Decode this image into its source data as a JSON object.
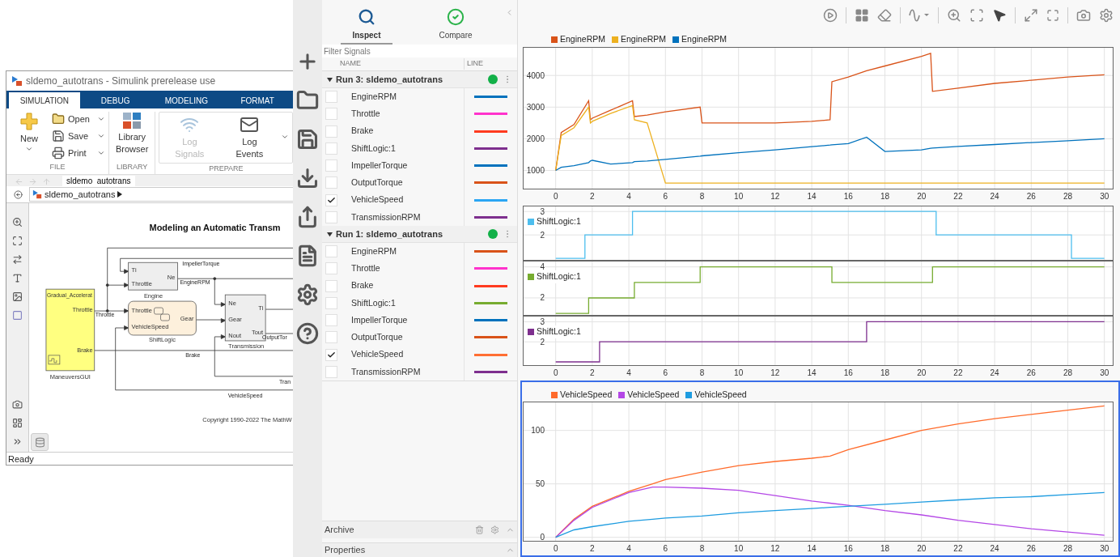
{
  "simulink_window": {
    "title": "sldemo_autotrans - Simulink prerelease use",
    "tabs": [
      {
        "label": "SIMULATION",
        "selected": true
      },
      {
        "label": "DEBUG",
        "selected": false
      },
      {
        "label": "MODELING",
        "selected": false
      },
      {
        "label": "FORMAT",
        "selected": false
      }
    ],
    "ribbon_sections": [
      {
        "title": "FILE",
        "kind": "plain",
        "buttons": [
          {
            "kind": "new",
            "label": "New",
            "disabled": false
          },
          {
            "kind": "open",
            "label": "Open",
            "disabled": false
          },
          {
            "kind": "save",
            "label": "Save",
            "disabled": false
          },
          {
            "kind": "print",
            "label": "Print",
            "disabled": false
          }
        ]
      },
      {
        "title": "LIBRARY",
        "kind": "plain",
        "buttons": [
          {
            "kind": "library",
            "label": "Library Browser",
            "disabled": false
          }
        ]
      },
      {
        "title": "PREPARE",
        "kind": "gallery",
        "buttons": [
          {
            "kind": "signals",
            "label": "Log Signals",
            "disabled": true
          },
          {
            "kind": "events",
            "label": "Log Events",
            "disabled": false
          }
        ]
      }
    ],
    "nav_tab": "sldemo  autotrans",
    "breadcrumb": "sldemo_autotrans",
    "diagram": {
      "title": "Modeling an Automatic Transm",
      "blocks": [
        {
          "name": "ManeuversGUI",
          "inner_title": "Gradual_Accelerat",
          "ports_out": [
            "Throttle",
            "Brake"
          ]
        },
        {
          "name": "Engine",
          "ports_in": [
            "Ti",
            "Throttle"
          ],
          "ports_out": [
            "Ne"
          ]
        },
        {
          "name": "ShiftLogic",
          "ports_in": [
            "Throttle",
            "VehicleSpeed"
          ],
          "ports_out": [
            "Gear"
          ]
        },
        {
          "name": "Transmission",
          "ports_in": [
            "Ne",
            "Gear",
            "Nout"
          ],
          "ports_out": [
            "Ti",
            "Tout"
          ]
        }
      ],
      "signals": [
        "ImpellerTorque",
        "EngineRPM",
        "Throttle",
        "Brake",
        "OutputTor",
        "Tran",
        "VehicleSpeed"
      ],
      "copyright": "Copyright 1990-2022 The MathW"
    },
    "status": "Ready"
  },
  "inspector": {
    "tabs": [
      {
        "label": "Inspect",
        "selected": true
      },
      {
        "label": "Compare",
        "selected": false
      }
    ],
    "filter": {
      "placeholder": "Filter Signals"
    },
    "columns": [
      "NAME",
      "LINE"
    ],
    "runs": [
      {
        "name": "Run 3: sldemo_autotrans",
        "expanded": true,
        "signals": [
          {
            "name": "EngineRPM",
            "checked": false,
            "color": "#0072bd"
          },
          {
            "name": "Throttle",
            "checked": false,
            "color": "#ff33cc"
          },
          {
            "name": "Brake",
            "checked": false,
            "color": "#ff3b1f"
          },
          {
            "name": "ShiftLogic:1",
            "checked": false,
            "color": "#7e2f8e"
          },
          {
            "name": "ImpellerTorque",
            "checked": false,
            "color": "#0072bd"
          },
          {
            "name": "OutputTorque",
            "checked": false,
            "color": "#d95319"
          },
          {
            "name": "VehicleSpeed",
            "checked": true,
            "color": "#2ba6f3"
          },
          {
            "name": "TransmissionRPM",
            "checked": false,
            "color": "#7e2f8e"
          }
        ]
      },
      {
        "name": "Run 1: sldemo_autotrans",
        "expanded": true,
        "signals": [
          {
            "name": "EngineRPM",
            "checked": false,
            "color": "#d95319"
          },
          {
            "name": "Throttle",
            "checked": false,
            "color": "#ff33cc"
          },
          {
            "name": "Brake",
            "checked": false,
            "color": "#ff3b1f"
          },
          {
            "name": "ShiftLogic:1",
            "checked": false,
            "color": "#77ac30"
          },
          {
            "name": "ImpellerTorque",
            "checked": false,
            "color": "#0072bd"
          },
          {
            "name": "OutputTorque",
            "checked": false,
            "color": "#d95319"
          },
          {
            "name": "VehicleSpeed",
            "checked": true,
            "color": "#ff6e33"
          },
          {
            "name": "TransmissionRPM",
            "checked": false,
            "color": "#7e2f8e"
          }
        ]
      }
    ],
    "panels": [
      "Archive",
      "Properties"
    ]
  },
  "plots": [
    {
      "selected": false,
      "chart_data": {
        "type": "line",
        "x": [
          0,
          0.3,
          1,
          1.8,
          1.9,
          2,
          3,
          4.2,
          4.3,
          5,
          6,
          7.9,
          8,
          10,
          12,
          14,
          15,
          15.1,
          16,
          17,
          18,
          20,
          20.5,
          20.6,
          22,
          24,
          26,
          28,
          30
        ],
        "xlim": [
          -1.8,
          30.5
        ],
        "ylim": [
          400,
          4900
        ],
        "grid": true,
        "xticks": [
          0,
          2,
          4,
          6,
          8,
          10,
          12,
          14,
          16,
          18,
          20,
          22,
          24,
          26,
          28,
          30
        ],
        "yticks": [
          1000,
          2000,
          3000,
          4000
        ],
        "series": [
          {
            "name": "EngineRPM",
            "color": "#d95319",
            "values": [
              1000,
              2200,
              2450,
              3200,
              2600,
              2650,
              2900,
              3200,
              2700,
              2750,
              2850,
              3000,
              2500,
              2500,
              2500,
              2550,
              2600,
              3800,
              3950,
              4150,
              4300,
              4600,
              4700,
              3500,
              3600,
              3750,
              3850,
              3950,
              4020
            ]
          },
          {
            "name": "EngineRPM",
            "color": "#edb120",
            "values": [
              1000,
              2100,
              2350,
              3000,
              2500,
              2550,
              2800,
              3050,
              2600,
              2500,
              600,
              600,
              600,
              600,
              600,
              600,
              600,
              600,
              600,
              600,
              600,
              600,
              600,
              600,
              600,
              600,
              600,
              600,
              600
            ]
          },
          {
            "name": "EngineRPM",
            "color": "#0072bd",
            "values": [
              1000,
              1100,
              1150,
              1250,
              1300,
              1320,
              1200,
              1250,
              1280,
              1300,
              1350,
              1450,
              1460,
              1560,
              1650,
              1750,
              1800,
              1810,
              1850,
              2050,
              1600,
              1650,
              1700,
              1710,
              1760,
              1820,
              1880,
              1940,
              2000
            ]
          }
        ]
      }
    },
    {
      "selected": false,
      "subplots": [
        {
          "chart_data": {
            "type": "line",
            "x": [
              0,
              1.6,
              1.6,
              4.2,
              4.2,
              20.8,
              20.8,
              28.2,
              28.2,
              30
            ],
            "xlim": [
              -1.8,
              30.5
            ],
            "ylim": [
              0.9,
              3.25
            ],
            "grid": true,
            "yticks": [
              2,
              3
            ],
            "series": [
              {
                "name": "ShiftLogic:1",
                "color": "#4dbeee",
                "values": [
                  1,
                  1,
                  2,
                  2,
                  3,
                  3,
                  2,
                  2,
                  1,
                  1
                ]
              }
            ]
          }
        },
        {
          "chart_data": {
            "type": "line",
            "x": [
              0,
              1.8,
              1.8,
              4.3,
              4.3,
              7.9,
              7.9,
              15.1,
              15.1,
              20.6,
              20.6,
              30
            ],
            "xlim": [
              -1.8,
              30.5
            ],
            "ylim": [
              0.85,
              4.4
            ],
            "grid": true,
            "yticks": [
              2,
              4
            ],
            "series": [
              {
                "name": "ShiftLogic:1",
                "color": "#77ac30",
                "values": [
                  1,
                  1,
                  2,
                  2,
                  3,
                  3,
                  4,
                  4,
                  3,
                  3,
                  4,
                  4
                ]
              }
            ]
          }
        },
        {
          "chart_data": {
            "type": "line",
            "x": [
              0,
              2.4,
              2.4,
              17,
              17,
              30
            ],
            "xlim": [
              -1.8,
              30.5
            ],
            "ylim": [
              0.8,
              3.3
            ],
            "grid": true,
            "xticks": [
              0,
              2,
              4,
              6,
              8,
              10,
              12,
              14,
              16,
              18,
              20,
              22,
              24,
              26,
              28,
              30
            ],
            "yticks": [
              2,
              3
            ],
            "series": [
              {
                "name": "ShiftLogic:1",
                "color": "#7e2f8e",
                "values": [
                  1,
                  1,
                  2,
                  2,
                  3,
                  3
                ]
              }
            ]
          }
        }
      ]
    },
    {
      "selected": true,
      "chart_data": {
        "type": "line",
        "x": [
          0,
          1,
          2,
          4,
          5.3,
          6,
          8,
          10,
          12,
          14,
          15,
          16,
          18,
          20,
          22,
          24,
          26,
          28,
          30
        ],
        "xlim": [
          -1.8,
          30.5
        ],
        "ylim": [
          -4,
          127
        ],
        "grid": true,
        "xticks": [
          0,
          2,
          4,
          6,
          8,
          10,
          12,
          14,
          16,
          18,
          20,
          22,
          24,
          26,
          28,
          30
        ],
        "yticks": [
          0,
          50,
          100
        ],
        "series": [
          {
            "name": "VehicleSpeed",
            "color": "#ff6b2b",
            "values": [
              0,
              17,
              29,
              43,
              50,
              54,
              61,
              67,
              71,
              74,
              76,
              82,
              91,
              100,
              106,
              111,
              115,
              119,
              123
            ]
          },
          {
            "name": "VehicleSpeed",
            "color": "#b447e6",
            "values": [
              0,
              16,
              28,
              42,
              47,
              47,
              46,
              44,
              39,
              34,
              32,
              30,
              25,
              21,
              16,
              12,
              8,
              5,
              2
            ]
          },
          {
            "name": "VehicleSpeed",
            "color": "#1e9ce0",
            "values": [
              0,
              7,
              10,
              15,
              17,
              18,
              20,
              23,
              25,
              27,
              28,
              29,
              31,
              33,
              35,
              37,
              38,
              40,
              42
            ]
          }
        ]
      }
    }
  ]
}
